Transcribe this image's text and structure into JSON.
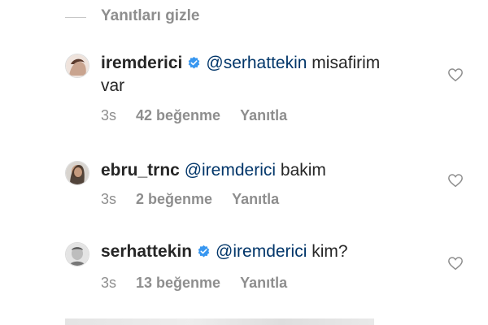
{
  "hide_replies_label": "Yanıtları gizle",
  "comments": [
    {
      "username": "iremderici",
      "verified": true,
      "mention": "@serhattekin",
      "text_line1": "misafirim",
      "text_line2": "var",
      "time": "3s",
      "likes": "42 beğenme",
      "reply_label": "Yanıtla"
    },
    {
      "username": "ebru_trnc",
      "verified": false,
      "mention": "@iremderici",
      "text_line1": "bakim",
      "time": "3s",
      "likes": "2 beğenme",
      "reply_label": "Yanıtla"
    },
    {
      "username": "serhattekin",
      "verified": true,
      "mention": "@iremderici",
      "text_line1": "kim?",
      "time": "3s",
      "likes": "13 beğenme",
      "reply_label": "Yanıtla"
    }
  ],
  "colors": {
    "verified_blue": "#3897f0",
    "mention_blue": "#003569",
    "meta_gray": "#8e8e8e"
  }
}
